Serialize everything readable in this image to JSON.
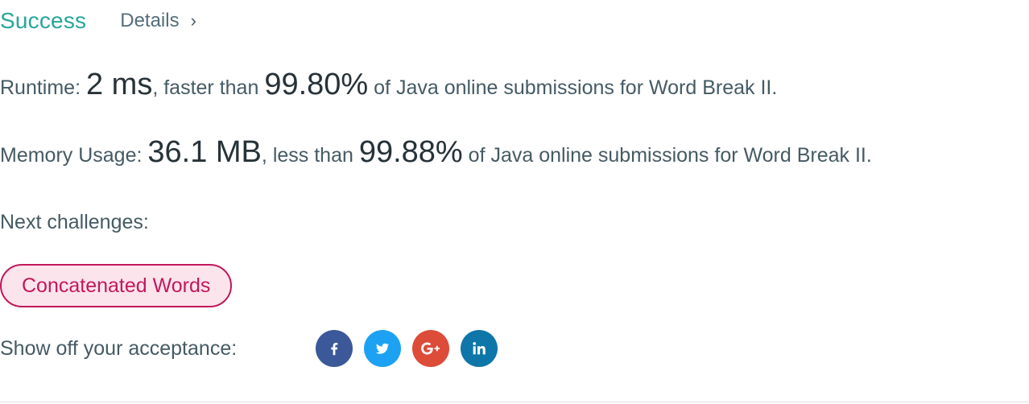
{
  "header": {
    "status": "Success",
    "details_label": "Details",
    "chevron": "›"
  },
  "runtime": {
    "label": "Runtime: ",
    "value": "2 ms",
    "comparison": ", faster than ",
    "percent": "99.80%",
    "suffix": " of Java online submissions for Word Break II."
  },
  "memory": {
    "label": "Memory Usage: ",
    "value": "36.1 MB",
    "comparison": ", less than ",
    "percent": "99.88%",
    "suffix": " of Java online submissions for Word Break II."
  },
  "next": {
    "label": "Next challenges:",
    "challenges": [
      {
        "label": "Concatenated Words"
      }
    ]
  },
  "share": {
    "label": "Show off your acceptance:",
    "icons": [
      {
        "name": "facebook-icon",
        "color": "#3b5998"
      },
      {
        "name": "twitter-icon",
        "color": "#1da1f2"
      },
      {
        "name": "google-plus-icon",
        "color": "#dd4b39"
      },
      {
        "name": "linkedin-icon",
        "color": "#0e76a8"
      }
    ]
  },
  "colors": {
    "success": "#26a69a",
    "text": "#455a64",
    "challenge_border": "#c2185b",
    "challenge_bg": "#fce4ec"
  }
}
